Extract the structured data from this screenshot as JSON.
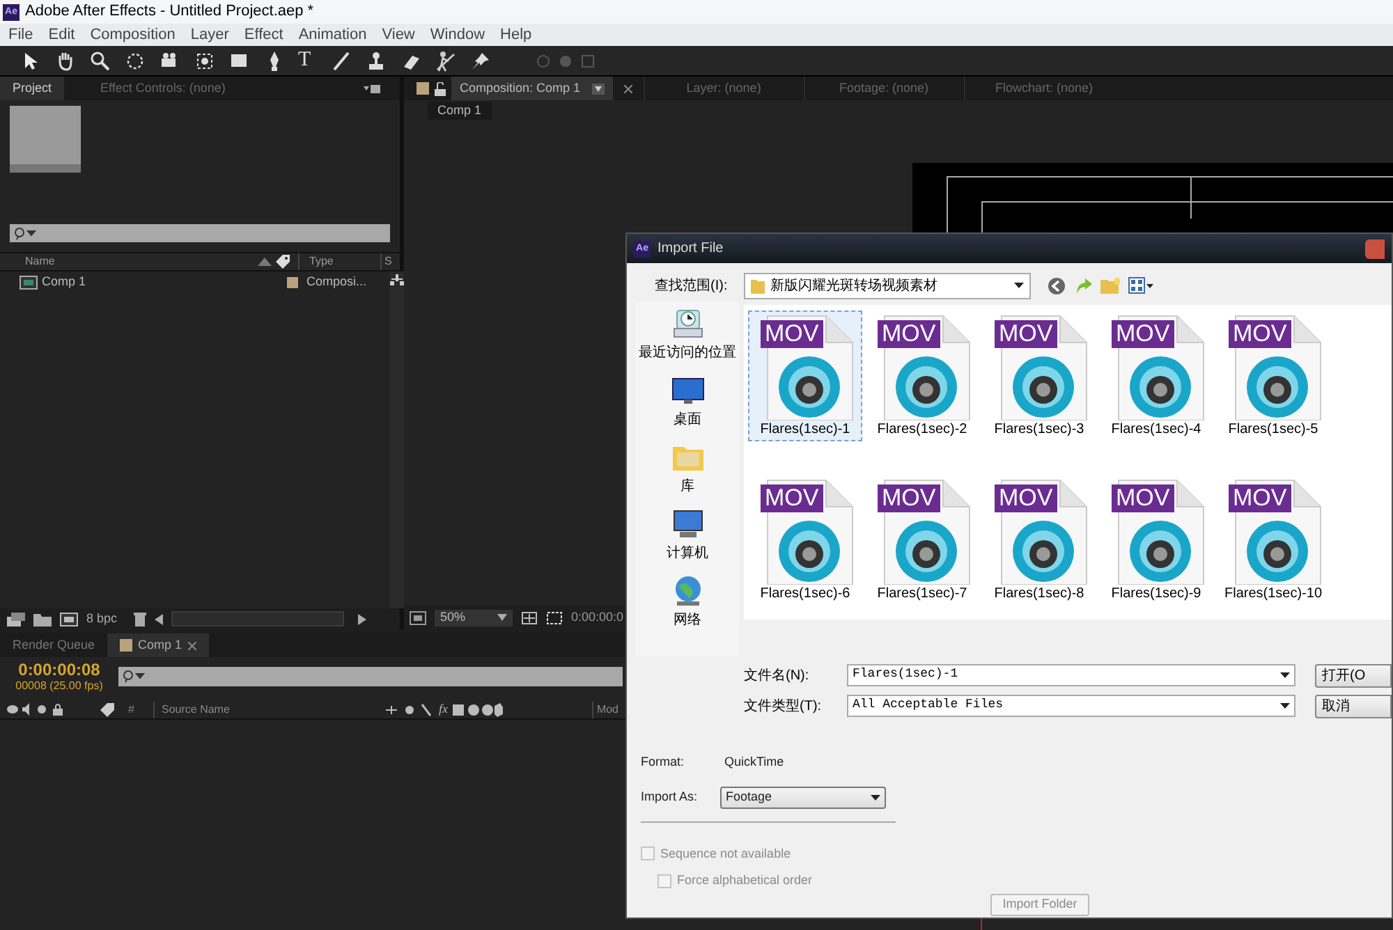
{
  "window": {
    "app_badge": "Ae",
    "title": "Adobe After Effects - Untitled Project.aep *"
  },
  "menu": [
    "File",
    "Edit",
    "Composition",
    "Layer",
    "Effect",
    "Animation",
    "View",
    "Window",
    "Help"
  ],
  "toolbar": {
    "type_tool_glyph": "T"
  },
  "project_panel": {
    "tabs": [
      {
        "label": "Project",
        "selected": true
      },
      {
        "label": "Effect Controls: (none)",
        "selected": false
      }
    ],
    "columns": [
      "Name",
      "Type",
      "S"
    ],
    "items": [
      {
        "name": "Comp 1",
        "type": "Composi..."
      }
    ],
    "bit_depth": "8 bpc"
  },
  "viewer": {
    "tabs": [
      {
        "label": "Composition: Comp 1",
        "selected": true
      },
      {
        "label": "Layer: (none)",
        "selected": false
      },
      {
        "label": "Footage: (none)",
        "selected": false
      },
      {
        "label": "Flowchart: (none)",
        "selected": false
      }
    ],
    "breadcrumb": "Comp 1",
    "zoom": "50%",
    "timecode": "0:00:00:0"
  },
  "timeline": {
    "tabs": [
      {
        "label": "Render Queue",
        "selected": false
      },
      {
        "label": "Comp 1",
        "selected": true
      }
    ],
    "timecode": "0:00:00:08",
    "frame_info": "00008 (25.00 fps)",
    "columns": [
      "#",
      "Source Name",
      "Mod"
    ],
    "effects_glyph": "fx"
  },
  "dialog": {
    "app_badge": "Ae",
    "title": "Import File",
    "look_in_label": "查找范围(I):",
    "folder": "新版闪耀光斑转场视频素材",
    "places": [
      {
        "kind": "recent",
        "label": "最近访问的位置"
      },
      {
        "kind": "desktop",
        "label": "桌面"
      },
      {
        "kind": "library",
        "label": "库"
      },
      {
        "kind": "computer",
        "label": "计算机"
      },
      {
        "kind": "network",
        "label": "网络"
      }
    ],
    "files": [
      {
        "badge": "MOV",
        "name": "Flares(1sec)-1",
        "selected": true
      },
      {
        "badge": "MOV",
        "name": "Flares(1sec)-2",
        "selected": false
      },
      {
        "badge": "MOV",
        "name": "Flares(1sec)-3",
        "selected": false
      },
      {
        "badge": "MOV",
        "name": "Flares(1sec)-4",
        "selected": false
      },
      {
        "badge": "MOV",
        "name": "Flares(1sec)-5",
        "selected": false
      },
      {
        "badge": "MOV",
        "name": "Flares(1sec)-6",
        "selected": false
      },
      {
        "badge": "MOV",
        "name": "Flares(1sec)-7",
        "selected": false
      },
      {
        "badge": "MOV",
        "name": "Flares(1sec)-8",
        "selected": false
      },
      {
        "badge": "MOV",
        "name": "Flares(1sec)-9",
        "selected": false
      },
      {
        "badge": "MOV",
        "name": "Flares(1sec)-10",
        "selected": false
      }
    ],
    "filename_label": "文件名(N):",
    "filename": "Flares(1sec)-1",
    "filetype_label": "文件类型(T):",
    "filetype": "All Acceptable Files",
    "open_button": "打开(O",
    "cancel_button": "取消",
    "format_label": "Format:",
    "format": "QuickTime",
    "import_as_label": "Import As:",
    "import_as": "Footage",
    "checkboxes": [
      {
        "label": "Sequence not available",
        "checked": false,
        "disabled": true
      },
      {
        "label": "Force alphabetical order",
        "checked": false,
        "disabled": true
      }
    ],
    "import_folder_button": {
      "label": "Import Folder",
      "disabled": true
    }
  }
}
